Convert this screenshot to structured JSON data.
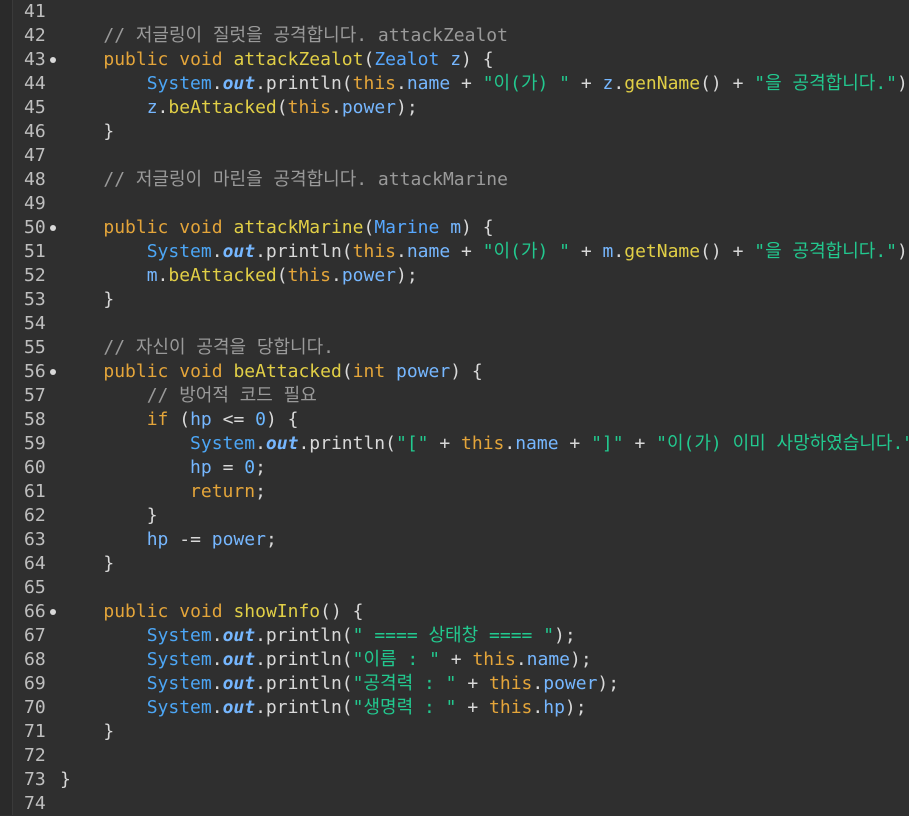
{
  "editor": {
    "gutter": [
      {
        "number": "41",
        "fold": false
      },
      {
        "number": "42",
        "fold": false
      },
      {
        "number": "43",
        "fold": true
      },
      {
        "number": "44",
        "fold": false
      },
      {
        "number": "45",
        "fold": false
      },
      {
        "number": "46",
        "fold": false
      },
      {
        "number": "47",
        "fold": false
      },
      {
        "number": "48",
        "fold": false
      },
      {
        "number": "49",
        "fold": false
      },
      {
        "number": "50",
        "fold": true
      },
      {
        "number": "51",
        "fold": false
      },
      {
        "number": "52",
        "fold": false
      },
      {
        "number": "53",
        "fold": false
      },
      {
        "number": "54",
        "fold": false
      },
      {
        "number": "55",
        "fold": false
      },
      {
        "number": "56",
        "fold": true
      },
      {
        "number": "57",
        "fold": false
      },
      {
        "number": "58",
        "fold": false
      },
      {
        "number": "59",
        "fold": false
      },
      {
        "number": "60",
        "fold": false
      },
      {
        "number": "61",
        "fold": false
      },
      {
        "number": "62",
        "fold": false
      },
      {
        "number": "63",
        "fold": false
      },
      {
        "number": "64",
        "fold": false
      },
      {
        "number": "65",
        "fold": false
      },
      {
        "number": "66",
        "fold": true
      },
      {
        "number": "67",
        "fold": false
      },
      {
        "number": "68",
        "fold": false
      },
      {
        "number": "69",
        "fold": false
      },
      {
        "number": "70",
        "fold": false
      },
      {
        "number": "71",
        "fold": false
      },
      {
        "number": "72",
        "fold": false
      },
      {
        "number": "73",
        "fold": false
      },
      {
        "number": "74",
        "fold": false
      }
    ],
    "lines": [
      [],
      [
        {
          "t": "    "
        },
        {
          "t": "// 저글링이 질럿을 공격합니다. attackZealot",
          "c": "com"
        }
      ],
      [
        {
          "t": "    "
        },
        {
          "t": "public",
          "c": "kw"
        },
        {
          "t": " "
        },
        {
          "t": "void",
          "c": "kw"
        },
        {
          "t": " "
        },
        {
          "t": "attackZealot",
          "c": "fn"
        },
        {
          "t": "("
        },
        {
          "t": "Zealot",
          "c": "type"
        },
        {
          "t": " "
        },
        {
          "t": "z",
          "c": "field"
        },
        {
          "t": ") {"
        }
      ],
      [
        {
          "t": "        "
        },
        {
          "t": "System",
          "c": "sys"
        },
        {
          "t": "."
        },
        {
          "t": "out",
          "c": "out"
        },
        {
          "t": ".println("
        },
        {
          "t": "this",
          "c": "kw"
        },
        {
          "t": "."
        },
        {
          "t": "name",
          "c": "field"
        },
        {
          "t": " + "
        },
        {
          "t": "\"이(가) \"",
          "c": "str"
        },
        {
          "t": " + "
        },
        {
          "t": "z",
          "c": "field"
        },
        {
          "t": "."
        },
        {
          "t": "genName",
          "c": "fn"
        },
        {
          "t": "() + "
        },
        {
          "t": "\"을 공격합니다.\"",
          "c": "str"
        },
        {
          "t": ");"
        }
      ],
      [
        {
          "t": "        "
        },
        {
          "t": "z",
          "c": "field"
        },
        {
          "t": "."
        },
        {
          "t": "beAttacked",
          "c": "fn"
        },
        {
          "t": "("
        },
        {
          "t": "this",
          "c": "kw"
        },
        {
          "t": "."
        },
        {
          "t": "power",
          "c": "field"
        },
        {
          "t": ");"
        }
      ],
      [
        {
          "t": "    }"
        }
      ],
      [],
      [
        {
          "t": "    "
        },
        {
          "t": "// 저글링이 마린을 공격합니다. attackMarine",
          "c": "com"
        }
      ],
      [],
      [
        {
          "t": "    "
        },
        {
          "t": "public",
          "c": "kw"
        },
        {
          "t": " "
        },
        {
          "t": "void",
          "c": "kw"
        },
        {
          "t": " "
        },
        {
          "t": "attackMarine",
          "c": "fn"
        },
        {
          "t": "("
        },
        {
          "t": "Marine",
          "c": "type"
        },
        {
          "t": " "
        },
        {
          "t": "m",
          "c": "field"
        },
        {
          "t": ") {"
        }
      ],
      [
        {
          "t": "        "
        },
        {
          "t": "System",
          "c": "sys"
        },
        {
          "t": "."
        },
        {
          "t": "out",
          "c": "out"
        },
        {
          "t": ".println("
        },
        {
          "t": "this",
          "c": "kw"
        },
        {
          "t": "."
        },
        {
          "t": "name",
          "c": "field"
        },
        {
          "t": " + "
        },
        {
          "t": "\"이(가) \"",
          "c": "str"
        },
        {
          "t": " + "
        },
        {
          "t": "m",
          "c": "field"
        },
        {
          "t": "."
        },
        {
          "t": "getName",
          "c": "fn"
        },
        {
          "t": "() + "
        },
        {
          "t": "\"을 공격합니다.\"",
          "c": "str"
        },
        {
          "t": ");"
        }
      ],
      [
        {
          "t": "        "
        },
        {
          "t": "m",
          "c": "field"
        },
        {
          "t": "."
        },
        {
          "t": "beAttacked",
          "c": "fn"
        },
        {
          "t": "("
        },
        {
          "t": "this",
          "c": "kw"
        },
        {
          "t": "."
        },
        {
          "t": "power",
          "c": "field"
        },
        {
          "t": ");"
        }
      ],
      [
        {
          "t": "    }"
        }
      ],
      [],
      [
        {
          "t": "    "
        },
        {
          "t": "// 자신이 공격을 당합니다.",
          "c": "com"
        }
      ],
      [
        {
          "t": "    "
        },
        {
          "t": "public",
          "c": "kw"
        },
        {
          "t": " "
        },
        {
          "t": "void",
          "c": "kw"
        },
        {
          "t": " "
        },
        {
          "t": "beAttacked",
          "c": "fn"
        },
        {
          "t": "("
        },
        {
          "t": "int",
          "c": "kw"
        },
        {
          "t": " "
        },
        {
          "t": "power",
          "c": "field"
        },
        {
          "t": ") {"
        }
      ],
      [
        {
          "t": "        "
        },
        {
          "t": "// 방어적 코드 필요",
          "c": "com"
        }
      ],
      [
        {
          "t": "        "
        },
        {
          "t": "if",
          "c": "kw"
        },
        {
          "t": " ("
        },
        {
          "t": "hp",
          "c": "field"
        },
        {
          "t": " <= "
        },
        {
          "t": "0",
          "c": "num"
        },
        {
          "t": ") {"
        }
      ],
      [
        {
          "t": "            "
        },
        {
          "t": "System",
          "c": "sys"
        },
        {
          "t": "."
        },
        {
          "t": "out",
          "c": "out"
        },
        {
          "t": ".println("
        },
        {
          "t": "\"[\"",
          "c": "str"
        },
        {
          "t": " + "
        },
        {
          "t": "this",
          "c": "kw"
        },
        {
          "t": "."
        },
        {
          "t": "name",
          "c": "field"
        },
        {
          "t": " + "
        },
        {
          "t": "\"]\"",
          "c": "str"
        },
        {
          "t": " + "
        },
        {
          "t": "\"이(가) 이미 사망하였습니다.\"",
          "c": "str"
        },
        {
          "t": ")"
        }
      ],
      [
        {
          "t": "            "
        },
        {
          "t": "hp",
          "c": "field"
        },
        {
          "t": " = "
        },
        {
          "t": "0",
          "c": "num"
        },
        {
          "t": ";"
        }
      ],
      [
        {
          "t": "            "
        },
        {
          "t": "return",
          "c": "kw"
        },
        {
          "t": ";"
        }
      ],
      [
        {
          "t": "        }"
        }
      ],
      [
        {
          "t": "        "
        },
        {
          "t": "hp",
          "c": "field"
        },
        {
          "t": " -= "
        },
        {
          "t": "power",
          "c": "field"
        },
        {
          "t": ";"
        }
      ],
      [
        {
          "t": "    }"
        }
      ],
      [],
      [
        {
          "t": "    "
        },
        {
          "t": "public",
          "c": "kw"
        },
        {
          "t": " "
        },
        {
          "t": "void",
          "c": "kw"
        },
        {
          "t": " "
        },
        {
          "t": "showInfo",
          "c": "fn"
        },
        {
          "t": "() {"
        }
      ],
      [
        {
          "t": "        "
        },
        {
          "t": "System",
          "c": "sys"
        },
        {
          "t": "."
        },
        {
          "t": "out",
          "c": "out"
        },
        {
          "t": ".println("
        },
        {
          "t": "\" ==== 상태창 ==== \"",
          "c": "str"
        },
        {
          "t": ");"
        }
      ],
      [
        {
          "t": "        "
        },
        {
          "t": "System",
          "c": "sys"
        },
        {
          "t": "."
        },
        {
          "t": "out",
          "c": "out"
        },
        {
          "t": ".println("
        },
        {
          "t": "\"이름 : \"",
          "c": "str"
        },
        {
          "t": " + "
        },
        {
          "t": "this",
          "c": "kw"
        },
        {
          "t": "."
        },
        {
          "t": "name",
          "c": "field"
        },
        {
          "t": ");"
        }
      ],
      [
        {
          "t": "        "
        },
        {
          "t": "System",
          "c": "sys"
        },
        {
          "t": "."
        },
        {
          "t": "out",
          "c": "out"
        },
        {
          "t": ".println("
        },
        {
          "t": "\"공격력 : \"",
          "c": "str"
        },
        {
          "t": " + "
        },
        {
          "t": "this",
          "c": "kw"
        },
        {
          "t": "."
        },
        {
          "t": "power",
          "c": "field"
        },
        {
          "t": ");"
        }
      ],
      [
        {
          "t": "        "
        },
        {
          "t": "System",
          "c": "sys"
        },
        {
          "t": "."
        },
        {
          "t": "out",
          "c": "out"
        },
        {
          "t": ".println("
        },
        {
          "t": "\"생명력 : \"",
          "c": "str"
        },
        {
          "t": " + "
        },
        {
          "t": "this",
          "c": "kw"
        },
        {
          "t": "."
        },
        {
          "t": "hp",
          "c": "field"
        },
        {
          "t": ");"
        }
      ],
      [
        {
          "t": "    }"
        }
      ],
      [],
      [
        {
          "t": "}"
        }
      ],
      []
    ],
    "colors": {
      "background": "#2f2f2f",
      "keyword": "#e4a53a",
      "type": "#57a8ff",
      "method": "#e1cf46",
      "string": "#22c98f",
      "number": "#6bb7ff",
      "comment": "#9a9a9a",
      "field": "#76b7ff"
    }
  }
}
